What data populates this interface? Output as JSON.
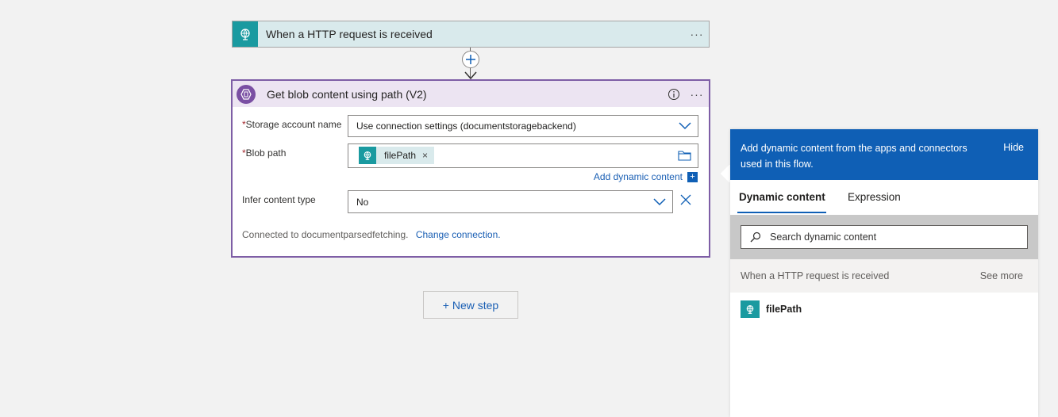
{
  "trigger": {
    "title": "When a HTTP request is received",
    "more": "···"
  },
  "action": {
    "title": "Get blob content using path (V2)",
    "more": "···",
    "fields": {
      "storage_account": {
        "label": "Storage account name",
        "value": "Use connection settings (documentstoragebackend)"
      },
      "blob_path": {
        "label": "Blob path",
        "token": "filePath",
        "token_remove": "×"
      },
      "infer_content_type": {
        "label": "Infer content type",
        "value": "No"
      }
    },
    "required_mark": "*",
    "add_dynamic_content": "Add dynamic content",
    "add_dynamic_plus": "+",
    "connected_text": "Connected to documentparsedfetching.",
    "change_connection": "Change connection."
  },
  "new_step": "+ New step",
  "dynamic_panel": {
    "header_text": "Add dynamic content from the apps and connectors used in this flow.",
    "hide": "Hide",
    "tabs": [
      "Dynamic content",
      "Expression"
    ],
    "search_placeholder": "Search dynamic content",
    "section_title": "When a HTTP request is received",
    "see_more": "See more",
    "items": [
      "filePath"
    ]
  },
  "colors": {
    "trigger_bg": "#d9eaec",
    "trigger_icon": "#1a9aa0",
    "action_border": "#7e5ea6",
    "action_header": "#ece4f2",
    "accent_blue": "#0f5fb5"
  }
}
